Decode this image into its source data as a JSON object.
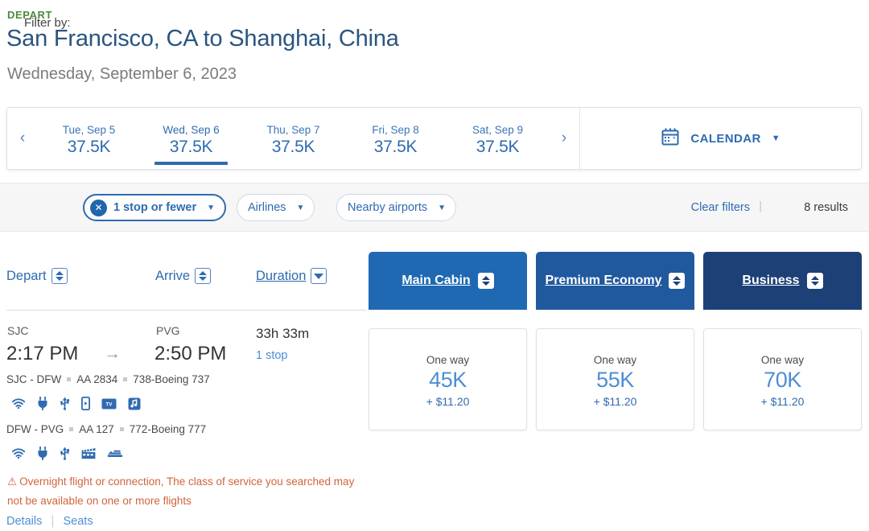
{
  "header": {
    "depart_label": "DEPART",
    "route": "San Francisco, CA to Shanghai, China",
    "date": "Wednesday, September 6, 2023"
  },
  "date_strip": {
    "prev_arrow": "‹",
    "next_arrow": "›",
    "days": [
      {
        "label": "Tue, Sep 5",
        "price": "37.5K",
        "active": false
      },
      {
        "label": "Wed, Sep 6",
        "price": "37.5K",
        "active": true
      },
      {
        "label": "Thu, Sep 7",
        "price": "37.5K",
        "active": false
      },
      {
        "label": "Fri, Sep 8",
        "price": "37.5K",
        "active": false
      },
      {
        "label": "Sat, Sep 9",
        "price": "37.5K",
        "active": false
      }
    ],
    "calendar_label": "CALENDAR",
    "calendar_caret": "▼",
    "calendar_icon": "calendar-icon"
  },
  "filters": {
    "filter_by_label": "Filter by:",
    "chips": [
      {
        "label": "1 stop or fewer",
        "selected": true,
        "close_icon": "✕"
      },
      {
        "label": "Airlines",
        "selected": false
      },
      {
        "label": "Nearby airports",
        "selected": false
      }
    ],
    "caret": "▼",
    "clear_filters": "Clear filters",
    "separator": "|",
    "results_count": "8 results"
  },
  "columns": {
    "depart": "Depart",
    "arrive": "Arrive",
    "duration": "Duration"
  },
  "cabins": [
    {
      "name": "Main Cabin",
      "color": "#1f69b3"
    },
    {
      "name": "Premium Economy",
      "color": "#20599d"
    },
    {
      "name": "Business",
      "color": "#1d4077"
    }
  ],
  "prices": [
    {
      "one_way_label": "One way",
      "miles": "45K",
      "taxes": "+ $11.20"
    },
    {
      "one_way_label": "One way",
      "miles": "55K",
      "taxes": "+ $11.20"
    },
    {
      "one_way_label": "One way",
      "miles": "70K",
      "taxes": "+ $11.20"
    }
  ],
  "flight": {
    "depart_airport": "SJC",
    "depart_time": "2:17 PM",
    "arrow": "→",
    "arrive_airport": "PVG",
    "arrive_time": "2:50 PM",
    "duration": "33h 33m",
    "stops": "1 stop",
    "segments": [
      {
        "route": "SJC - DFW",
        "flight_number": "AA 2834",
        "aircraft": "738-Boeing 737",
        "amenities": [
          "wifi-icon",
          "power-outlet-icon",
          "usb-icon",
          "device-icon",
          "tv-icon",
          "music-icon"
        ]
      },
      {
        "route": "DFW - PVG",
        "flight_number": "AA 127",
        "aircraft": "772-Boeing 777",
        "amenities": [
          "wifi-icon",
          "power-outlet-icon",
          "usb-icon",
          "movie-icon",
          "lie-flat-seat-icon"
        ]
      }
    ],
    "warning_icon": "⚠",
    "warning_text": "Overnight flight or connection, The class of service you searched may not be available on one or more flights",
    "details_link": "Details",
    "link_separator": "|",
    "seats_link": "Seats"
  }
}
